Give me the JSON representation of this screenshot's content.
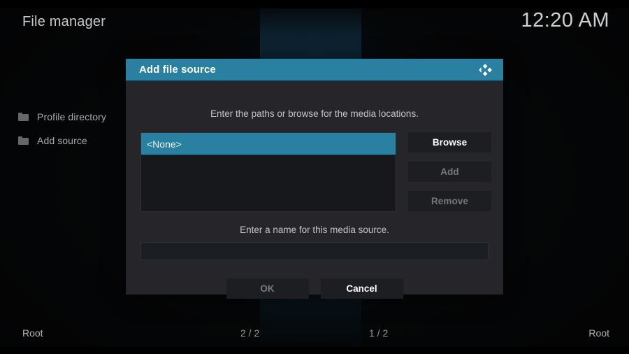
{
  "window": {
    "title": "File manager",
    "clock": "12:20 AM"
  },
  "sidebar": {
    "items": [
      {
        "label": "Profile directory",
        "icon": "folder-icon"
      },
      {
        "label": "Add source",
        "icon": "folder-icon"
      }
    ]
  },
  "statusbar": {
    "left_path": "Root",
    "left_count": "2 / 2",
    "right_count": "1 / 2",
    "right_path": "Root"
  },
  "dialog": {
    "title": "Add file source",
    "logo": "kodi-logo",
    "hint_paths": "Enter the paths or browse for the media locations.",
    "hint_name": "Enter a name for this media source.",
    "path_list": [
      {
        "label": "<None>",
        "selected": true
      }
    ],
    "side_buttons": [
      {
        "label": "Browse",
        "enabled": true
      },
      {
        "label": "Add",
        "enabled": false
      },
      {
        "label": "Remove",
        "enabled": false
      }
    ],
    "name_input": {
      "value": "",
      "placeholder": ""
    },
    "footer_buttons": [
      {
        "label": "OK",
        "enabled": false
      },
      {
        "label": "Cancel",
        "enabled": true
      }
    ]
  },
  "colors": {
    "accent_teal": "#2a80a0",
    "dialog_bg": "#26262a",
    "button_bg": "#1d1e22",
    "text_primary": "#ffffff",
    "text_disabled": "#76767c"
  }
}
